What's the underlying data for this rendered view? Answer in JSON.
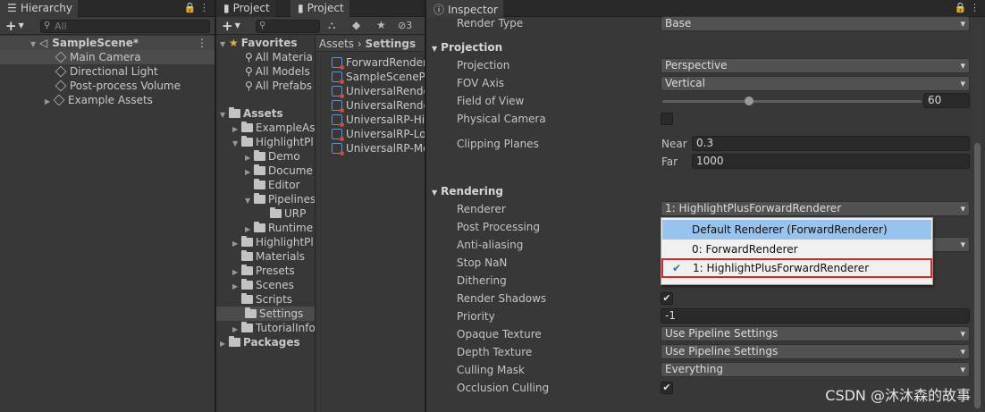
{
  "hierarchy": {
    "tab_label": "Hierarchy",
    "search_placeholder": "All",
    "scene_name": "SampleScene*",
    "items": [
      "Main Camera",
      "Directional Light",
      "Post-process Volume",
      "Example Assets"
    ]
  },
  "project_tabs": [
    "Project",
    "Project"
  ],
  "project": {
    "favorites_label": "Favorites",
    "favorites": [
      "All Materia",
      "All Models",
      "All Prefabs"
    ],
    "assets_label": "Assets",
    "tree": [
      "ExampleAs",
      "HighlightPl",
      "Demo",
      "Docume",
      "Editor",
      "Pipelines",
      "URP",
      "Runtime",
      "HighlightPl",
      "Materials",
      "Presets",
      "Scenes",
      "Scripts",
      "Settings",
      "TutorialInfo"
    ],
    "packages_label": "Packages",
    "hidden_count": "3",
    "breadcrumb": [
      "Assets",
      "Settings"
    ],
    "files": [
      "ForwardRendere",
      "SampleScenePr",
      "UniversalRende",
      "UniversalRende",
      "UniversalRP-Hi",
      "UniversalRP-Lo",
      "UniversalRP-Me"
    ]
  },
  "inspector": {
    "tab_label": "Inspector",
    "render_type_label": "Render Type",
    "render_type_value": "Base",
    "projection_section": "Projection",
    "projection_label": "Projection",
    "projection_value": "Perspective",
    "fov_axis_label": "FOV Axis",
    "fov_axis_value": "Vertical",
    "fov_label": "Field of View",
    "fov_value": "60",
    "physical_camera_label": "Physical Camera",
    "clipping_label": "Clipping Planes",
    "near_label": "Near",
    "near_value": "0.3",
    "far_label": "Far",
    "far_value": "1000",
    "rendering_section": "Rendering",
    "renderer_label": "Renderer",
    "renderer_value": "1: HighlightPlusForwardRenderer",
    "post_processing_label": "Post Processing",
    "anti_aliasing_label": "Anti-aliasing",
    "stop_nan_label": "Stop NaN",
    "dithering_label": "Dithering",
    "render_shadows_label": "Render Shadows",
    "priority_label": "Priority",
    "priority_value": "-1",
    "opaque_texture_label": "Opaque Texture",
    "opaque_texture_value": "Use Pipeline Settings",
    "depth_texture_label": "Depth Texture",
    "depth_texture_value": "Use Pipeline Settings",
    "culling_mask_label": "Culling Mask",
    "culling_mask_value": "Everything",
    "occlusion_culling_label": "Occlusion Culling"
  },
  "renderer_popup": {
    "options": [
      "Default Renderer (ForwardRenderer)",
      "0: ForwardRenderer",
      "1: HighlightPlusForwardRenderer"
    ]
  },
  "watermark": "CSDN @沐沐森的故事",
  "colors": {
    "popup_highlight": "#97c3ee",
    "marker_red": "#d22a2a"
  }
}
